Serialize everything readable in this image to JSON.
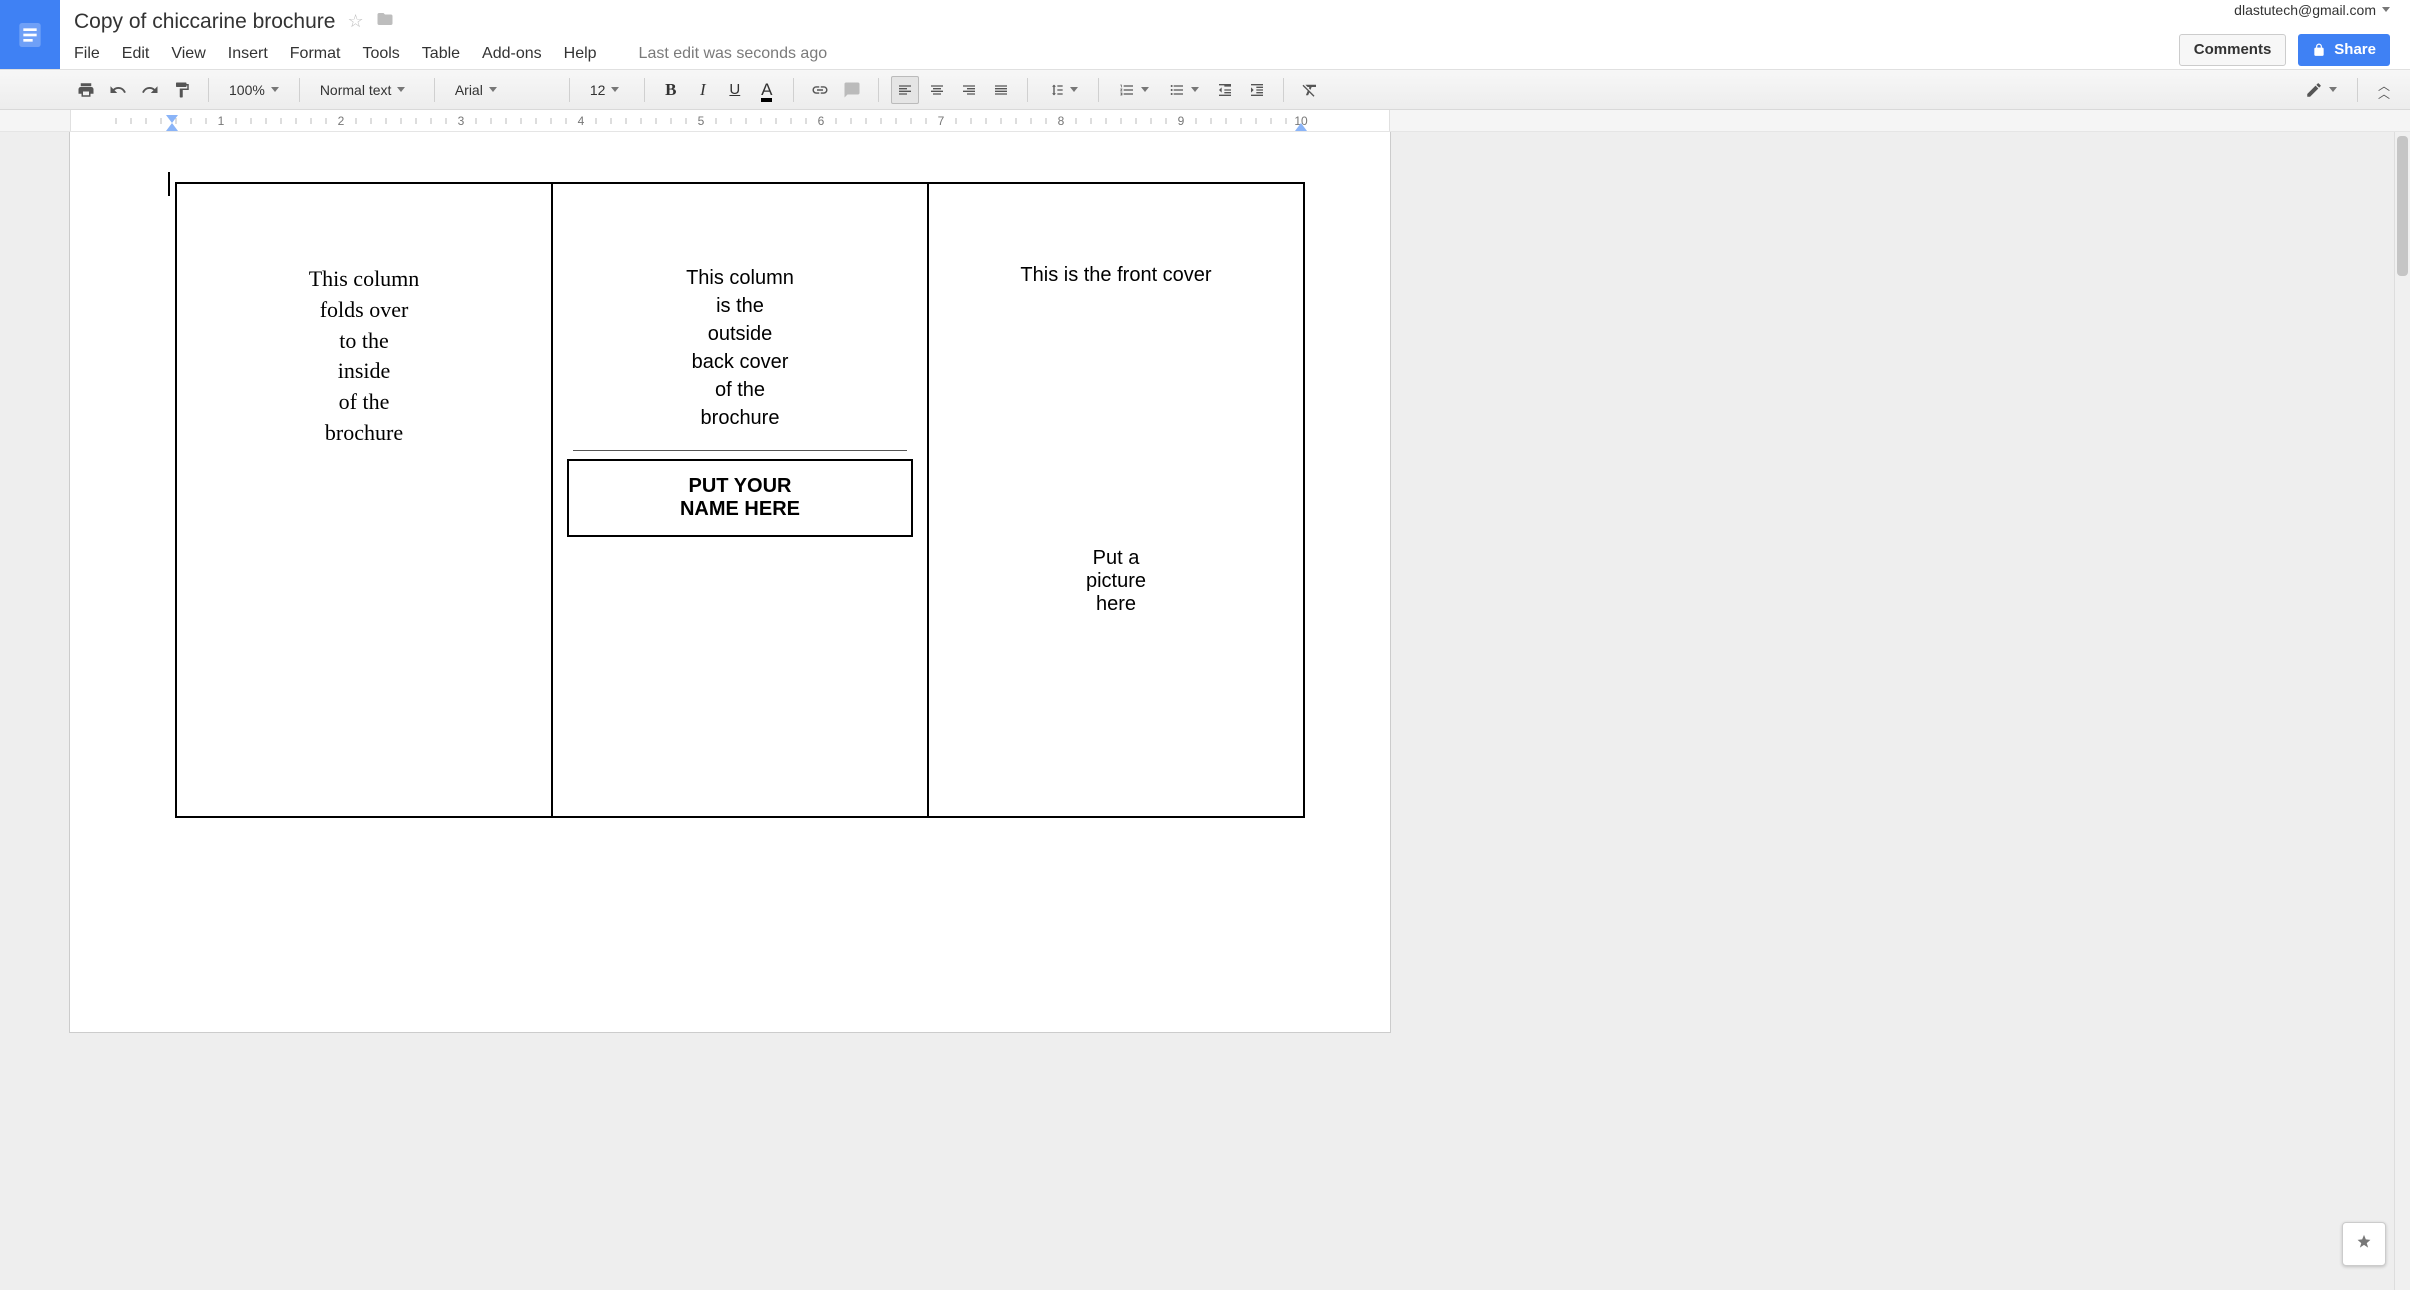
{
  "app": {
    "account_email": "dlastutech@gmail.com",
    "doc_title": "Copy of chiccarine brochure",
    "last_edit": "Last edit was seconds ago"
  },
  "menubar": {
    "file": "File",
    "edit": "Edit",
    "view": "View",
    "insert": "Insert",
    "format": "Format",
    "tools": "Tools",
    "table": "Table",
    "addons": "Add-ons",
    "help": "Help"
  },
  "buttons": {
    "comments": "Comments",
    "share": "Share"
  },
  "toolbar": {
    "zoom": "100%",
    "style": "Normal text",
    "font": "Arial",
    "font_size": "12"
  },
  "ruler": {
    "labels": [
      "1",
      "2",
      "3",
      "4",
      "5",
      "6",
      "7",
      "8",
      "9",
      "10"
    ]
  },
  "doc": {
    "col1": "This column\nfolds over\nto the\ninside\nof the\nbrochure",
    "col2_top": "This column\nis the\noutside\nback cover\nof the\nbrochure",
    "col2_box": "PUT YOUR\nNAME HERE",
    "col3_top": "This is the front cover",
    "col3_sub": "Put a\npicture\nhere"
  }
}
